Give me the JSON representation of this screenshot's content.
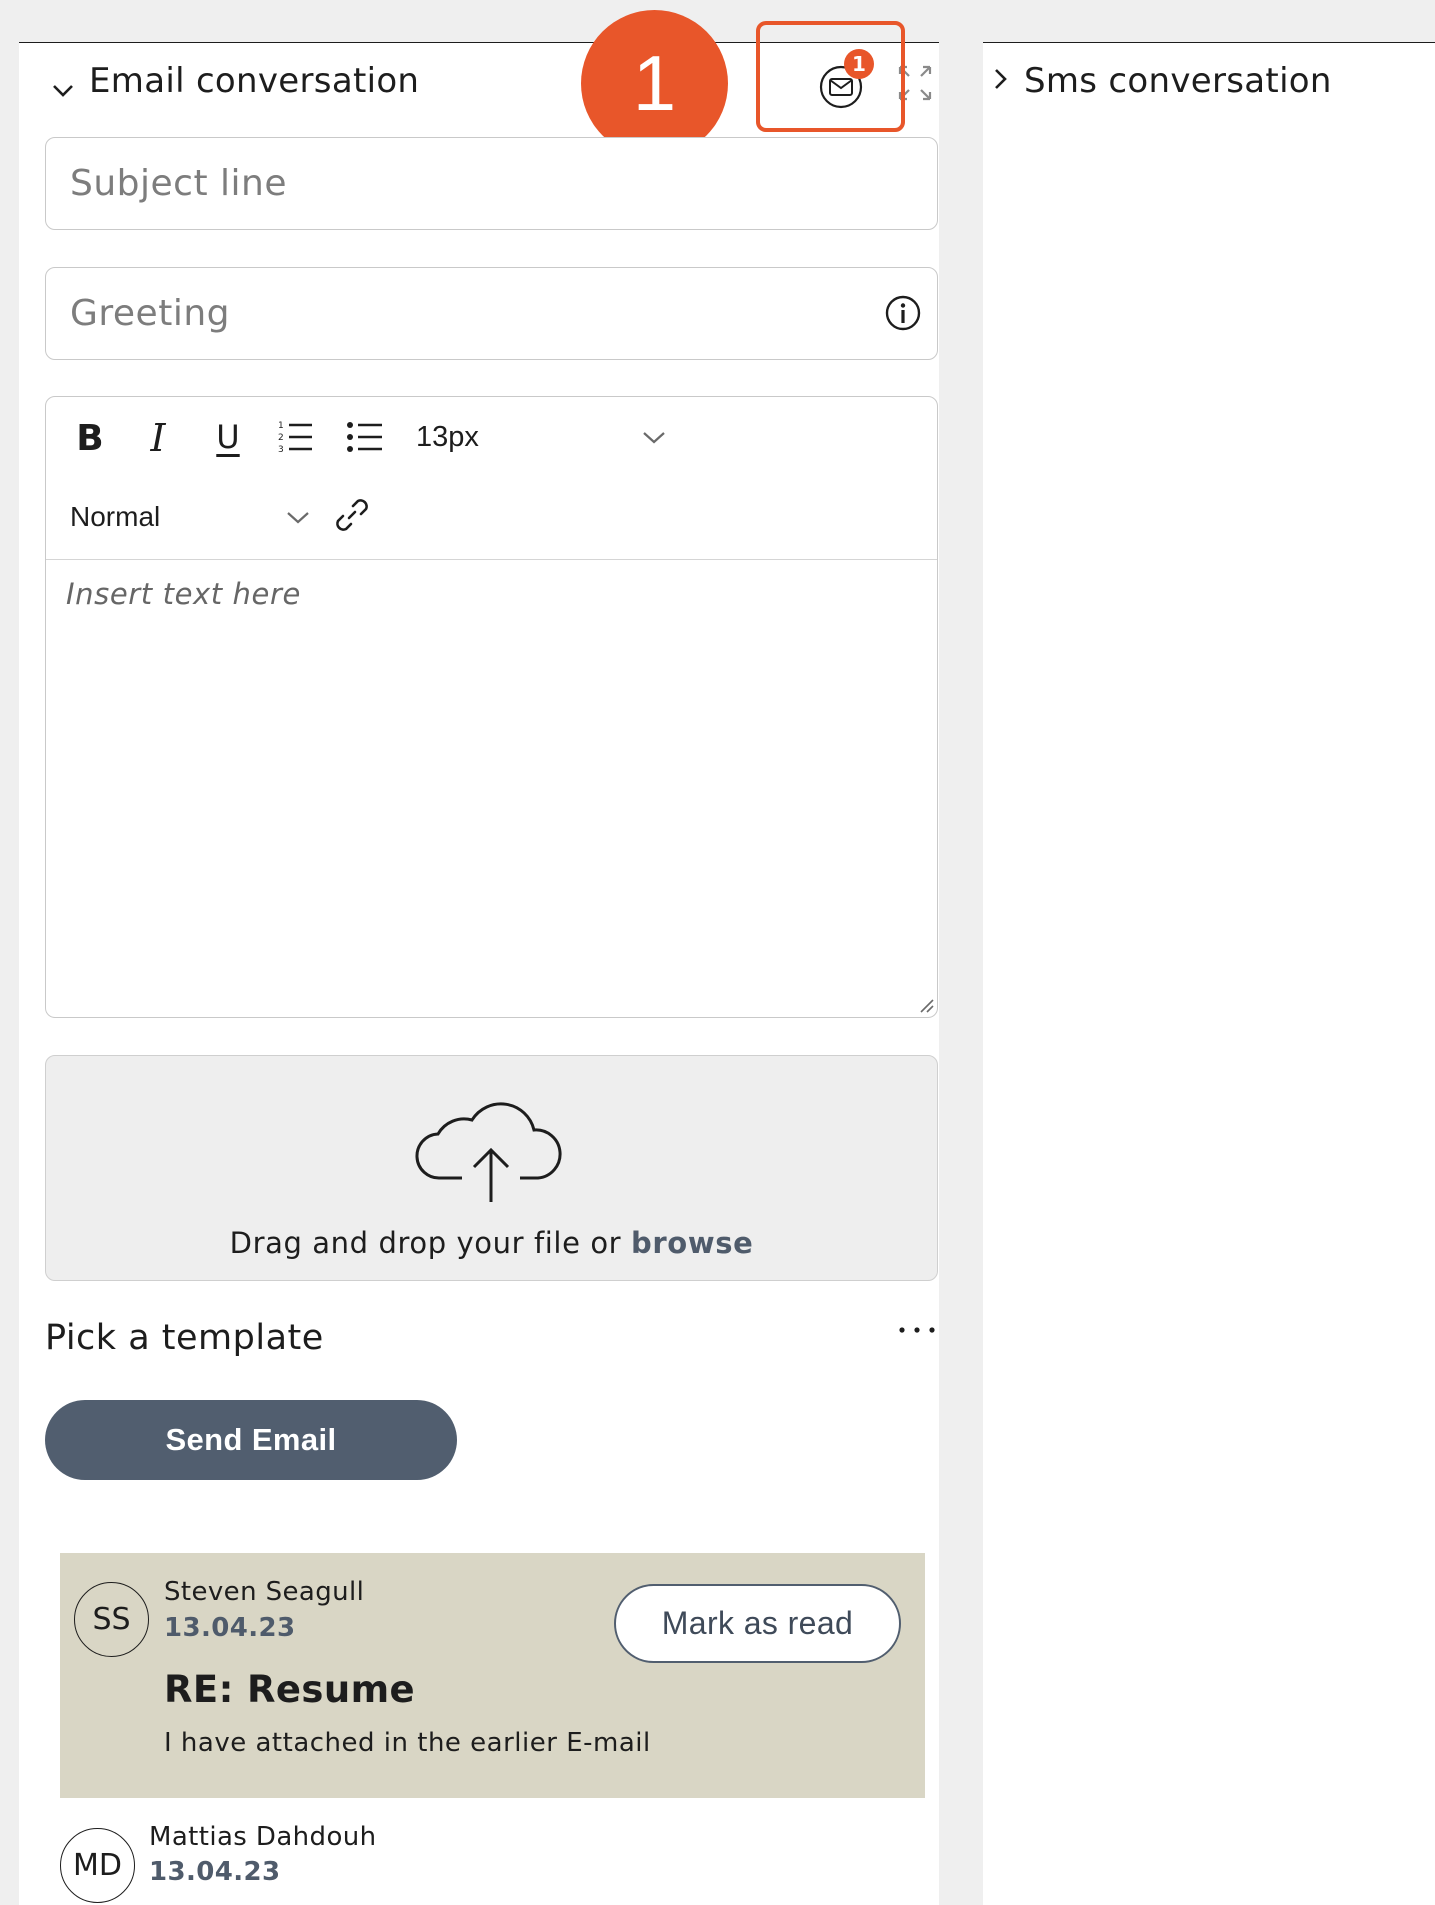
{
  "email_panel": {
    "title": "Email conversation",
    "chevron_icon": "chevron-down-icon",
    "notification_count": "1",
    "callout_number": "1",
    "subject_placeholder": "Subject line",
    "greeting_placeholder": "Greeting",
    "toolbar": {
      "bold": "B",
      "italic": "I",
      "underline": "U",
      "font_size": "13px",
      "block_format": "Normal"
    },
    "editor_placeholder": "Insert text here",
    "dropzone": {
      "text": "Drag and drop your file or",
      "browse_link": "browse"
    },
    "template_label": "Pick a template",
    "more_icon": "ellipsis-icon",
    "send_button": "Send Email",
    "messages": [
      {
        "initials": "SS",
        "sender": "Steven Seagull",
        "date": "13.04.23",
        "subject": "RE: Resume",
        "preview": "I have attached in the earlier E-mail",
        "action": "Mark as read"
      },
      {
        "initials": "MD",
        "sender": "Mattias Dahdouh",
        "date": "13.04.23"
      }
    ]
  },
  "sms_panel": {
    "title": "Sms conversation",
    "chevron_icon": "chevron-right-icon"
  },
  "colors": {
    "accent": "#e8562a",
    "button": "#515e6f",
    "unread_card": "#d9d6c5"
  }
}
